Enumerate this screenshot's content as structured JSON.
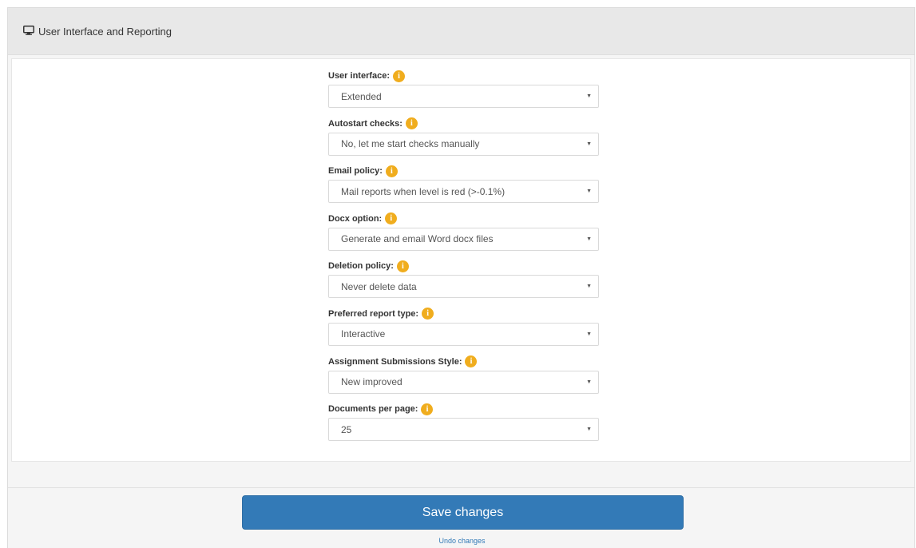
{
  "panel": {
    "title": "User Interface and Reporting",
    "icon": "monitor-icon"
  },
  "fields": [
    {
      "label": "User interface:",
      "value": "Extended"
    },
    {
      "label": "Autostart checks:",
      "value": "No, let me start checks manually"
    },
    {
      "label": "Email policy:",
      "value": "Mail reports when level is red (>-0.1%)"
    },
    {
      "label": "Docx option:",
      "value": "Generate and email Word docx files"
    },
    {
      "label": "Deletion policy:",
      "value": "Never delete data"
    },
    {
      "label": "Preferred report type:",
      "value": "Interactive"
    },
    {
      "label": "Assignment Submissions Style:",
      "value": "New improved"
    },
    {
      "label": "Documents per page:",
      "value": "25"
    }
  ],
  "info_glyph": "i",
  "caret_glyph": "▼",
  "actions": {
    "save_label": "Save changes",
    "undo_label": "Undo changes"
  },
  "colors": {
    "primary": "#337ab7",
    "info": "#f0ad1e"
  }
}
